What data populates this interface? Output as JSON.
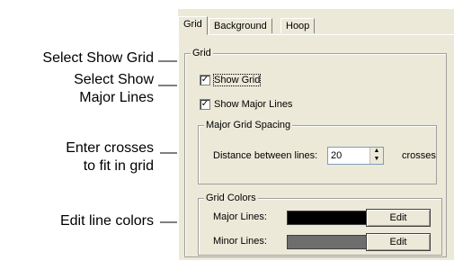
{
  "callouts": {
    "show_grid": "Select Show Grid",
    "show_major_line1": "Select Show",
    "show_major_line2": "Major Lines",
    "crosses_line1": "Enter crosses",
    "crosses_line2": "to fit in grid",
    "edit_colors": "Edit line colors"
  },
  "tabs": [
    {
      "label": "Grid",
      "active": true
    },
    {
      "label": "Background",
      "active": false
    },
    {
      "label": "Hoop",
      "active": false
    }
  ],
  "grid_group": {
    "title": "Grid",
    "show_grid": {
      "label": "Show Grid",
      "checked": true
    },
    "show_major_lines": {
      "label": "Show Major Lines",
      "checked": true
    },
    "check_mark": "✓"
  },
  "spacing_group": {
    "title": "Major Grid Spacing",
    "distance_label": "Distance between lines:",
    "distance_value": "20",
    "unit": "crosses"
  },
  "colors_group": {
    "title": "Grid Colors",
    "major_label": "Major Lines:",
    "major_color": "#000000",
    "minor_label": "Minor Lines:",
    "minor_color": "#6e6e6e",
    "edit_label": "Edit"
  },
  "spinner": {
    "up": "▲",
    "down": "▼"
  }
}
